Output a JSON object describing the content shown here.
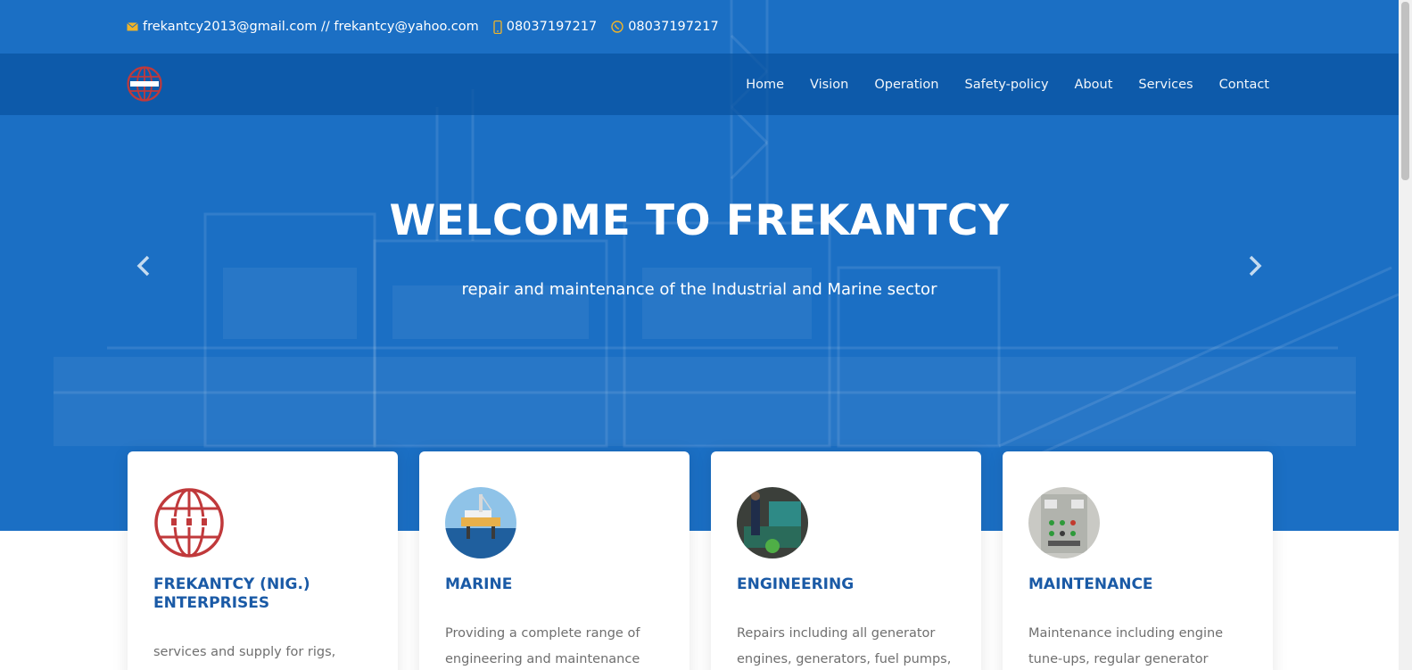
{
  "topbar": {
    "email": "frekantcy2013@gmail.com // frekantcy@yahoo.com",
    "phone": "08037197217",
    "whatsapp": "08037197217",
    "icons": [
      "envelope-icon",
      "mobile-phone-icon",
      "whatsapp-icon"
    ],
    "icon_color": "#f0b429"
  },
  "nav": {
    "items": [
      "Home",
      "Vision",
      "Operation",
      "Safety-policy",
      "About",
      "Services",
      "Contact"
    ]
  },
  "hero": {
    "title": "WELCOME TO FREKANTCY",
    "subtitle": "repair and maintenance of the Industrial and Marine sector",
    "background_color": "#1b6fc4"
  },
  "cards": [
    {
      "title": "FREKANTCY (NIG.) ENTERPRISES",
      "text": "services and supply for rigs,",
      "image": "company-logo"
    },
    {
      "title": "MARINE",
      "text": "Providing a complete range of engineering and maintenance",
      "image": "offshore-platform-photo"
    },
    {
      "title": "ENGINEERING",
      "text": "Repairs including all generator engines, generators, fuel pumps,",
      "image": "engine-room-photo"
    },
    {
      "title": "MAINTENANCE",
      "text": "Maintenance including engine tune-ups, regular generator",
      "image": "control-panel-photo"
    }
  ],
  "colors": {
    "accent": "#1a5aa6",
    "navbar": "#0852a0",
    "logo_red": "#c0393b"
  }
}
